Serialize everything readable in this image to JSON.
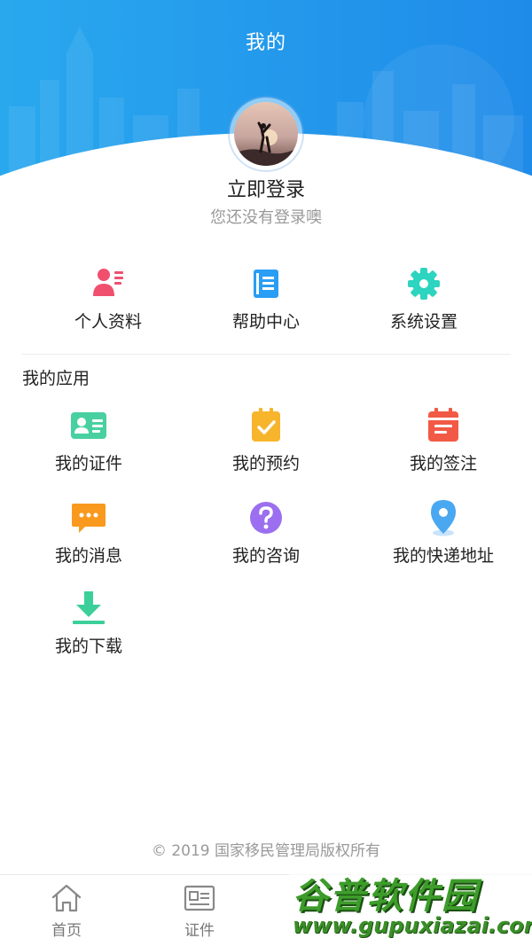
{
  "header": {
    "title": "我的"
  },
  "profile": {
    "login_title": "立即登录",
    "login_subtitle": "您还没有登录噢"
  },
  "quick_actions": [
    {
      "label": "个人资料",
      "icon": "profile-card-icon",
      "color": "#f0506e"
    },
    {
      "label": "帮助中心",
      "icon": "help-book-icon",
      "color": "#2a9df4"
    },
    {
      "label": "系统设置",
      "icon": "gear-icon",
      "color": "#2dd4c0"
    }
  ],
  "my_apps": {
    "title": "我的应用",
    "items": [
      {
        "label": "我的证件",
        "icon": "id-card-icon",
        "color": "#48d0a0"
      },
      {
        "label": "我的预约",
        "icon": "appointment-clipboard-icon",
        "color": "#f7b52c"
      },
      {
        "label": "我的签注",
        "icon": "endorsement-calendar-icon",
        "color": "#f25a45"
      },
      {
        "label": "我的消息",
        "icon": "message-bubble-icon",
        "color": "#f99a1e"
      },
      {
        "label": "我的咨询",
        "icon": "question-circle-icon",
        "color": "#9b6ff0"
      },
      {
        "label": "我的快递地址",
        "icon": "location-pin-icon",
        "color": "#4aa8f0"
      },
      {
        "label": "我的下载",
        "icon": "download-icon",
        "color": "#3ccf9a"
      }
    ]
  },
  "footer": {
    "copyright": "© 2019 国家移民管理局版权所有"
  },
  "tabbar": [
    {
      "label": "首页",
      "icon": "home-icon"
    },
    {
      "label": "证件",
      "icon": "document-card-icon"
    }
  ],
  "watermark": {
    "logo_text": "谷普软件园",
    "url_text": "www.gupuxiazai.com"
  }
}
